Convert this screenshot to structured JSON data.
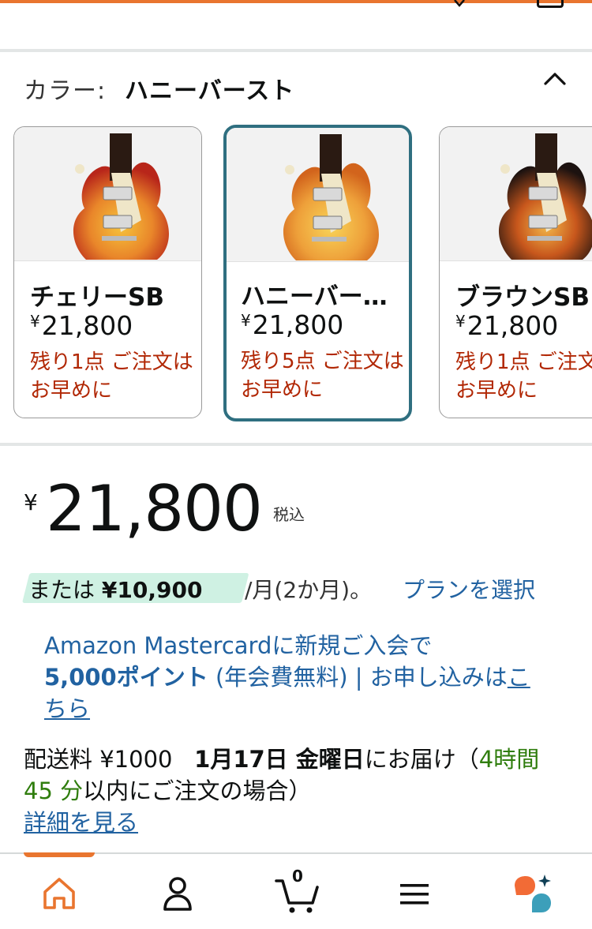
{
  "theme": {
    "accent": "#e9752f",
    "link": "#2162a1",
    "alert": "#b12704",
    "selected_border": "#2f6f80",
    "installment_bg": "#cff1e3",
    "timer_green": "#2f7d0d"
  },
  "color_selector": {
    "label": "カラー:",
    "selected_value": "ハニーバースト",
    "collapse_icon": "chevron-up-icon",
    "options": [
      {
        "name": "チェリーSB",
        "currency": "¥",
        "price": "21,800",
        "stock": "残り1点 ご注文はお早めに",
        "selected": false
      },
      {
        "name": "ハニーバー…",
        "currency": "¥",
        "price": "21,800",
        "stock": "残り5点 ご注文はお早めに",
        "selected": true
      },
      {
        "name": "ブラウンSB",
        "currency": "¥",
        "price": "21,800",
        "stock": "残り1点 ご注文はお早めに",
        "selected": false
      }
    ]
  },
  "price": {
    "currency": "¥",
    "amount": "21,800",
    "tax_note": "税込"
  },
  "installment": {
    "prefix": "または",
    "amount": "¥10,900",
    "suffix": "/月(2か月)。",
    "plan_link": "プランを選択"
  },
  "promo": {
    "text1": "Amazon Mastercardに新規ご入会で",
    "points": "5,000ポイント",
    "text2": "(年会費無料) | お申し込みは",
    "link": "こちら"
  },
  "delivery": {
    "fee": "配送料 ¥1000",
    "date": "1月17日 金曜日",
    "text1": "にお届け（",
    "timer": "4時間 45 分",
    "text2": "以内にご注文の場合）",
    "details_link": "詳細を見る"
  },
  "bottom_nav": {
    "items": [
      "home-icon",
      "account-icon",
      "cart-icon",
      "menu-icon",
      "rufus-ai-icon"
    ],
    "cart_count": "0"
  }
}
